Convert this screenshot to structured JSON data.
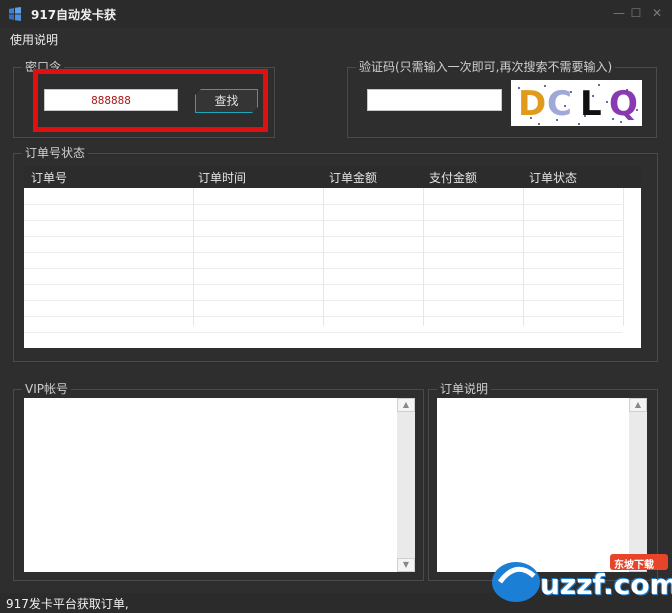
{
  "window": {
    "title": "917自动发卡获"
  },
  "menu": {
    "help_label": "使用说明"
  },
  "password_group": {
    "label": "密口令",
    "value": "888888",
    "search_label": "查找"
  },
  "captcha_group": {
    "label": "验证码(只需输入一次即可,再次搜索不需要输入)",
    "value": "",
    "captcha_text": "DCLQ"
  },
  "orders_group": {
    "label": "订单号状态",
    "columns": [
      "订单号",
      "订单时间",
      "订单金额",
      "支付金额",
      "订单状态"
    ],
    "rows": []
  },
  "vip_group": {
    "label": "VIP帐号"
  },
  "notes_group": {
    "label": "订单说明"
  },
  "status": {
    "text": "917发卡平台获取订单,"
  },
  "watermark": {
    "text": "uzzf.com",
    "badge": "东坡下载"
  },
  "colors": {
    "highlight": "#e01010",
    "button_border": "#1aa7b8",
    "background": "#2e2e2e"
  }
}
